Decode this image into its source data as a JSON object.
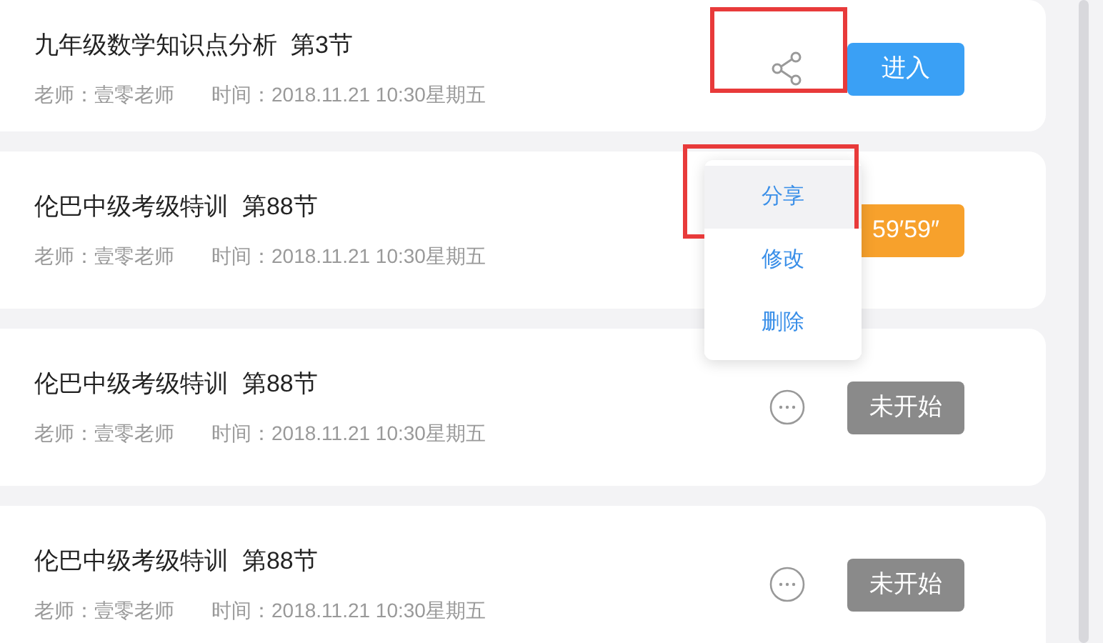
{
  "lessons": [
    {
      "title": "九年级数学知识点分析  第3节",
      "teacher": "老师：壹零老师",
      "time": "时间：2018.11.21 10:30星期五",
      "kind": "share",
      "icon_marked": true,
      "button": {
        "kind": "enter",
        "label": "进入"
      }
    },
    {
      "title": "伦巴中级考级特训  第88节",
      "teacher": "老师：壹零老师",
      "time": "时间：2018.11.21 10:30星期五",
      "kind": "menu_open",
      "icon_marked": false,
      "button": {
        "kind": "countdown",
        "label": "59′59″"
      }
    },
    {
      "title": "伦巴中级考级特训  第88节",
      "teacher": "老师：壹零老师",
      "time": "时间：2018.11.21 10:30星期五",
      "kind": "more",
      "icon_marked": false,
      "button": {
        "kind": "not_started",
        "label": "未开始"
      }
    },
    {
      "title": "伦巴中级考级特训  第88节",
      "teacher": "老师：壹零老师",
      "time": "时间：2018.11.21 10:30星期五",
      "kind": "more",
      "icon_marked": false,
      "button": {
        "kind": "not_started",
        "label": "未开始"
      }
    }
  ],
  "menu": {
    "items": [
      {
        "label": "分享",
        "selected": true,
        "marked": true
      },
      {
        "label": "修改",
        "selected": false,
        "marked": false
      },
      {
        "label": "删除",
        "selected": false,
        "marked": false
      }
    ]
  }
}
